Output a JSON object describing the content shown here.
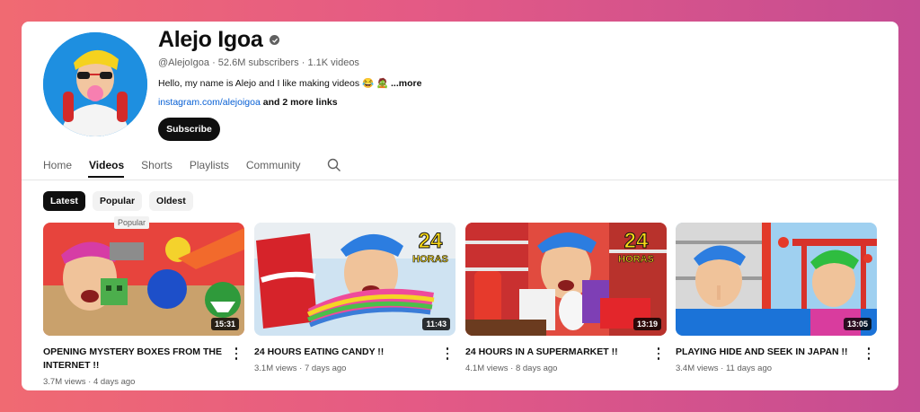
{
  "channel": {
    "name": "Alejo Igoa",
    "meta": "@AlejoIgoa · 52.6M subscribers · 1.1K videos",
    "description": "Hello, my name is Alejo and I like making videos 😂 🧟",
    "description_more": "...more",
    "link": "instagram.com/alejoigoa",
    "link_suffix": " and 2 more links",
    "subscribe_label": "Subscribe"
  },
  "tabs": [
    {
      "label": "Home"
    },
    {
      "label": "Videos",
      "active": true
    },
    {
      "label": "Shorts"
    },
    {
      "label": "Playlists"
    },
    {
      "label": "Community"
    }
  ],
  "chips": [
    {
      "label": "Latest",
      "active": true
    },
    {
      "label": "Popular"
    },
    {
      "label": "Oldest"
    }
  ],
  "tooltip": "Popular",
  "videos": [
    {
      "title": "OPENING MYSTERY BOXES FROM THE INTERNET !!",
      "duration": "15:31",
      "views": "3.7M views",
      "age": "4 days ago",
      "thumb_text": ""
    },
    {
      "title": "24 HOURS EATING CANDY !!",
      "duration": "11:43",
      "views": "3.1M views",
      "age": "7 days ago",
      "thumb_text": "24 HORAS"
    },
    {
      "title": "24 HOURS IN A SUPERMARKET !!",
      "duration": "13:19",
      "views": "4.1M views",
      "age": "8 days ago",
      "thumb_text": "24 HORAS"
    },
    {
      "title": "PLAYING HIDE AND SEEK IN JAPAN !!",
      "duration": "13:05",
      "views": "3.4M views",
      "age": "11 days ago",
      "thumb_text": ""
    }
  ],
  "colors": {
    "accent": "#0f0f0f",
    "link": "#065fd4",
    "chip_bg": "#f2f2f2"
  }
}
